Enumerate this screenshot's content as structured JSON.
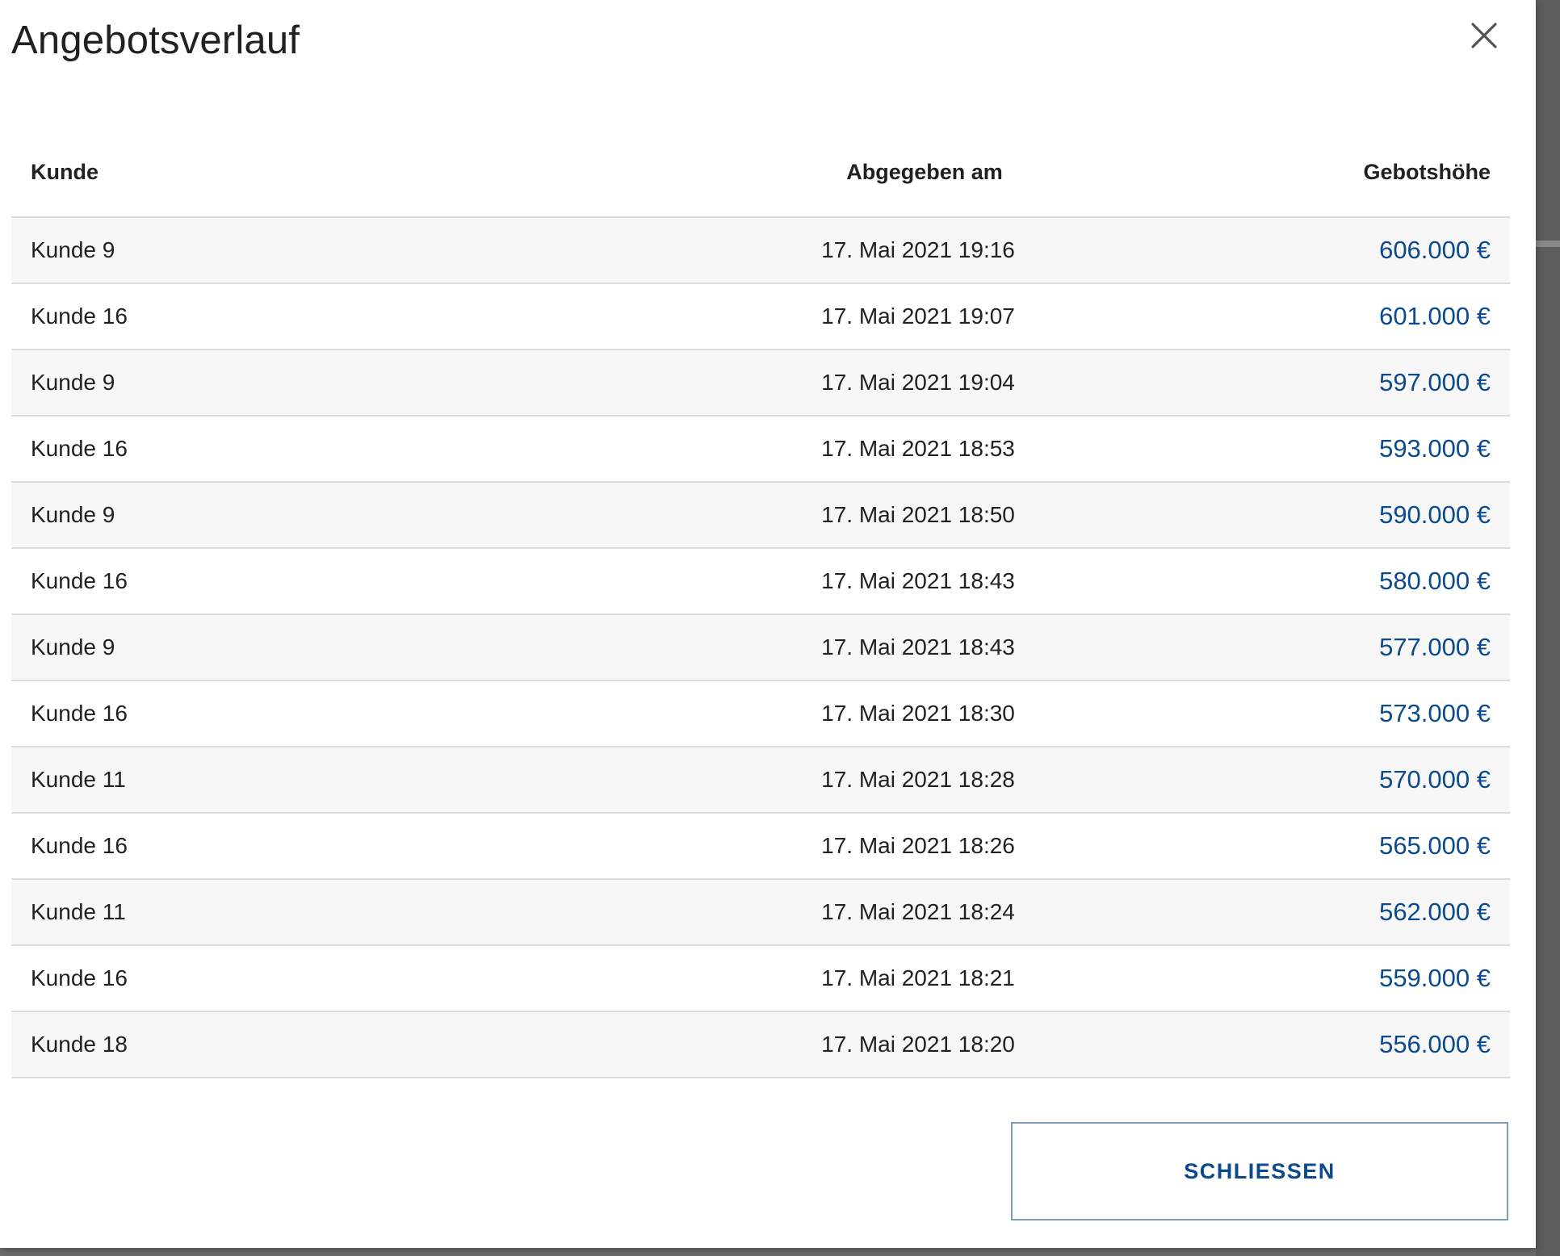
{
  "dialog": {
    "title": "Angebotsverlauf",
    "close_icon": "close-icon",
    "close_button_label": "SCHLIESSEN"
  },
  "table": {
    "headers": {
      "kunde": "Kunde",
      "date": "Abgegeben am",
      "amount": "Gebotshöhe"
    },
    "rows": [
      {
        "kunde": "Kunde 9",
        "date": "17. Mai 2021 19:16",
        "amount": "606.000 €"
      },
      {
        "kunde": "Kunde 16",
        "date": "17. Mai 2021 19:07",
        "amount": "601.000 €"
      },
      {
        "kunde": "Kunde 9",
        "date": "17. Mai 2021 19:04",
        "amount": "597.000 €"
      },
      {
        "kunde": "Kunde 16",
        "date": "17. Mai 2021 18:53",
        "amount": "593.000 €"
      },
      {
        "kunde": "Kunde 9",
        "date": "17. Mai 2021 18:50",
        "amount": "590.000 €"
      },
      {
        "kunde": "Kunde 16",
        "date": "17. Mai 2021 18:43",
        "amount": "580.000 €"
      },
      {
        "kunde": "Kunde 9",
        "date": "17. Mai 2021 18:43",
        "amount": "577.000 €"
      },
      {
        "kunde": "Kunde 16",
        "date": "17. Mai 2021 18:30",
        "amount": "573.000 €"
      },
      {
        "kunde": "Kunde 11",
        "date": "17. Mai 2021 18:28",
        "amount": "570.000 €"
      },
      {
        "kunde": "Kunde 16",
        "date": "17. Mai 2021 18:26",
        "amount": "565.000 €"
      },
      {
        "kunde": "Kunde 11",
        "date": "17. Mai 2021 18:24",
        "amount": "562.000 €"
      },
      {
        "kunde": "Kunde 16",
        "date": "17. Mai 2021 18:21",
        "amount": "559.000 €"
      },
      {
        "kunde": "Kunde 18",
        "date": "17. Mai 2021 18:20",
        "amount": "556.000 €"
      }
    ]
  },
  "colors": {
    "accent": "#0b4a8c",
    "text": "#212121",
    "row_alt": "#f7f7f7",
    "divider": "#dcdcdc",
    "button_border": "#7f9bb8"
  }
}
